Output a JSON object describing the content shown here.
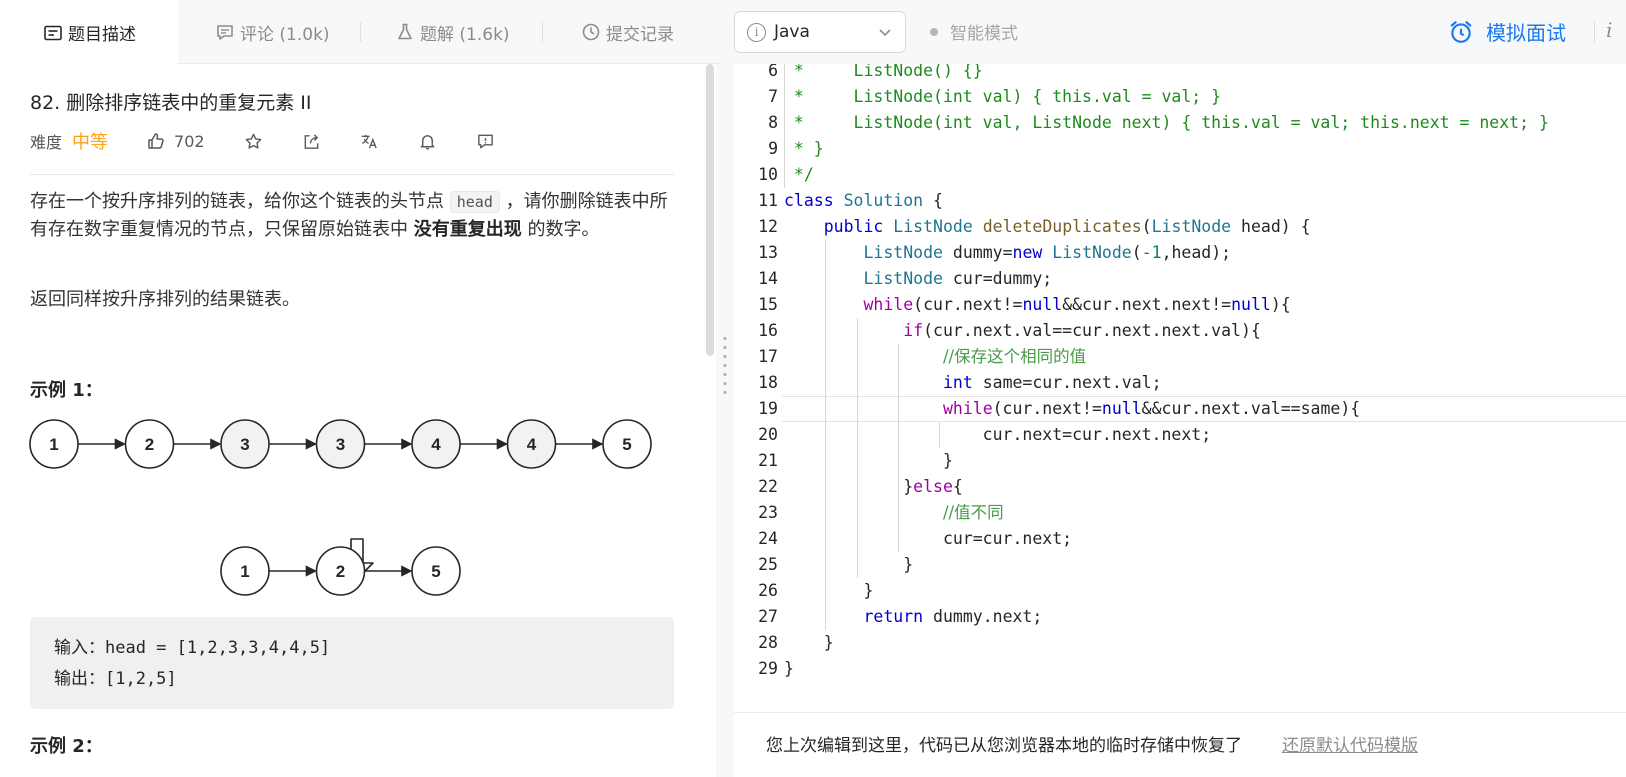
{
  "tabs": [
    {
      "label": "题目描述",
      "icon": "description-icon"
    },
    {
      "label": "评论 (1.0k)",
      "icon": "comment-icon"
    },
    {
      "label": "题解 (1.6k)",
      "icon": "flask-icon"
    },
    {
      "label": "提交记录",
      "icon": "clock-icon"
    }
  ],
  "problem": {
    "title": "82. 删除排序链表中的重复元素 II",
    "difficulty_label": "难度",
    "difficulty": "中等",
    "likes": "702",
    "desc_1": "存在一个按升序排列的链表，给你这个链表的头节点",
    "desc_code": "head",
    "desc_2": "，请你删除链表中所有存在数字重复情况的节点，只保留原始链表中",
    "desc_bold": "没有重复出现",
    "desc_3": "的数字。",
    "desc_para2": "返回同样按升序排列的结果链表。",
    "example1_title": "示例 1：",
    "example2_title": "示例 2：",
    "input_line": "输入：head = [1,2,3,3,4,4,5]",
    "output_line": "输出：[1,2,5]"
  },
  "diagram": {
    "before": [
      {
        "value": "1",
        "duplicate": false
      },
      {
        "value": "2",
        "duplicate": false
      },
      {
        "value": "3",
        "duplicate": true
      },
      {
        "value": "3",
        "duplicate": true
      },
      {
        "value": "4",
        "duplicate": true
      },
      {
        "value": "4",
        "duplicate": true
      },
      {
        "value": "5",
        "duplicate": false
      }
    ],
    "after": [
      "1",
      "2",
      "5"
    ]
  },
  "toolbar": {
    "language": "Java",
    "smart_mode": "智能模式",
    "mock_interview": "模拟面试"
  },
  "colors": {
    "accent": "#1a7aec",
    "difficulty_medium": "#ffa116"
  },
  "code_lines": [
    {
      "n": "6",
      "t": " *     ListNode() {}"
    },
    {
      "n": "7",
      "t": " *     ListNode(int val) { this.val = val; }"
    },
    {
      "n": "8",
      "t": " *     ListNode(int val, ListNode next) { this.val = val; this.next = next; }"
    },
    {
      "n": "9",
      "t": " * }"
    },
    {
      "n": "10",
      "t": " */"
    },
    {
      "n": "11",
      "t": "class Solution {"
    },
    {
      "n": "12",
      "t": "    public ListNode deleteDuplicates(ListNode head) {"
    },
    {
      "n": "13",
      "t": "        ListNode dummy=new ListNode(-1,head);"
    },
    {
      "n": "14",
      "t": "        ListNode cur=dummy;"
    },
    {
      "n": "15",
      "t": "        while(cur.next!=null&&cur.next.next!=null){"
    },
    {
      "n": "16",
      "t": "            if(cur.next.val==cur.next.next.val){"
    },
    {
      "n": "17",
      "t": "                //保存这个相同的值"
    },
    {
      "n": "18",
      "t": "                int same=cur.next.val;"
    },
    {
      "n": "19",
      "t": "                while(cur.next!=null&&cur.next.val==same){"
    },
    {
      "n": "20",
      "t": "                    cur.next=cur.next.next;"
    },
    {
      "n": "21",
      "t": "                }"
    },
    {
      "n": "22",
      "t": "            }else{"
    },
    {
      "n": "23",
      "t": "                //值不同"
    },
    {
      "n": "24",
      "t": "                cur=cur.next;"
    },
    {
      "n": "25",
      "t": "            }"
    },
    {
      "n": "26",
      "t": "        }"
    },
    {
      "n": "27",
      "t": "        return dummy.next;"
    },
    {
      "n": "28",
      "t": "    }"
    },
    {
      "n": "29",
      "t": "}"
    }
  ],
  "status": {
    "restore_message": "您上次编辑到这里，代码已从您浏览器本地的临时存储中恢复了",
    "restore_link": "还原默认代码模版"
  }
}
